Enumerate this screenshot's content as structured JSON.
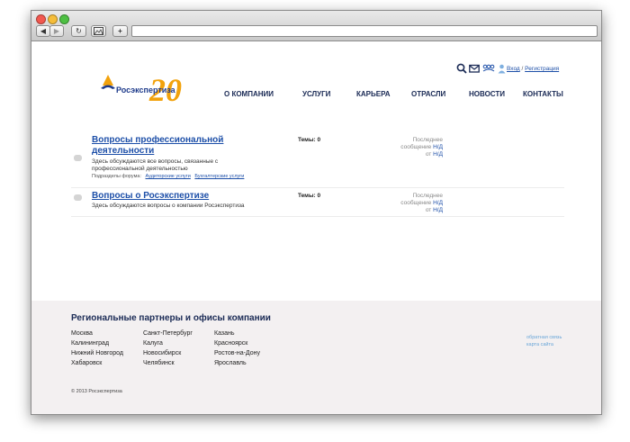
{
  "toolbar": {
    "back": "◀",
    "forward": "▶",
    "reload": "↻",
    "plus": "+"
  },
  "brand": {
    "name": "Росэкспертиза",
    "jubilee": "20",
    "colors": {
      "blue": "#1d3a8a",
      "orange": "#f2a20c",
      "link": "#1d4fa8"
    }
  },
  "header": {
    "icons": [
      "search-icon",
      "mail-icon",
      "people-icon",
      "user-icon"
    ],
    "login": "Вход",
    "separator": "/",
    "register": "Регистрация"
  },
  "nav": [
    "О КОМПАНИИ",
    "УСЛУГИ",
    "КАРЬЕРА",
    "ОТРАСЛИ",
    "НОВОСТИ",
    "КОНТАКТЫ"
  ],
  "forums": [
    {
      "title_line1": "Вопросы профессиональной",
      "title_line2": "деятельности",
      "description_line1": "Здесь обсуждаются все вопросы, связанные с",
      "description_line2": "профессиональной деятельностью",
      "subforums_label": "Подразделы форума:",
      "subforums": [
        "Аудиторские услуги",
        "Бухгалтерские услуги"
      ],
      "topics": "Темы: 0",
      "last_line1": "Последнее",
      "last_line2": "сообщение",
      "last_na": "Н/Д",
      "last_from": "от",
      "last_author": "Н/Д"
    },
    {
      "title_line1": "Вопросы о Росэкспертизе",
      "description_line1": "Здесь обсуждаются вопросы о компании Росэкспертиза",
      "topics": "Темы: 0",
      "last_line1": "Последнее",
      "last_line2": "сообщение",
      "last_na": "Н/Д",
      "last_from": "от",
      "last_author": "Н/Д"
    }
  ],
  "footer": {
    "title": "Региональные партнеры и офисы компании",
    "cities": {
      "col1": [
        "Москва",
        "Калининград",
        "Нижний Новгород",
        "Хабаровск"
      ],
      "col2": [
        "Санкт-Петербург",
        "Калуга",
        "Новосибирск",
        "Челябинск"
      ],
      "col3": [
        "Казань",
        "Красноярск",
        "Ростов-на-Дону",
        "Ярославль"
      ]
    },
    "links": [
      "обратная связь",
      "карта сайта"
    ],
    "copyright": "© 2013 Росэкспертиза"
  }
}
